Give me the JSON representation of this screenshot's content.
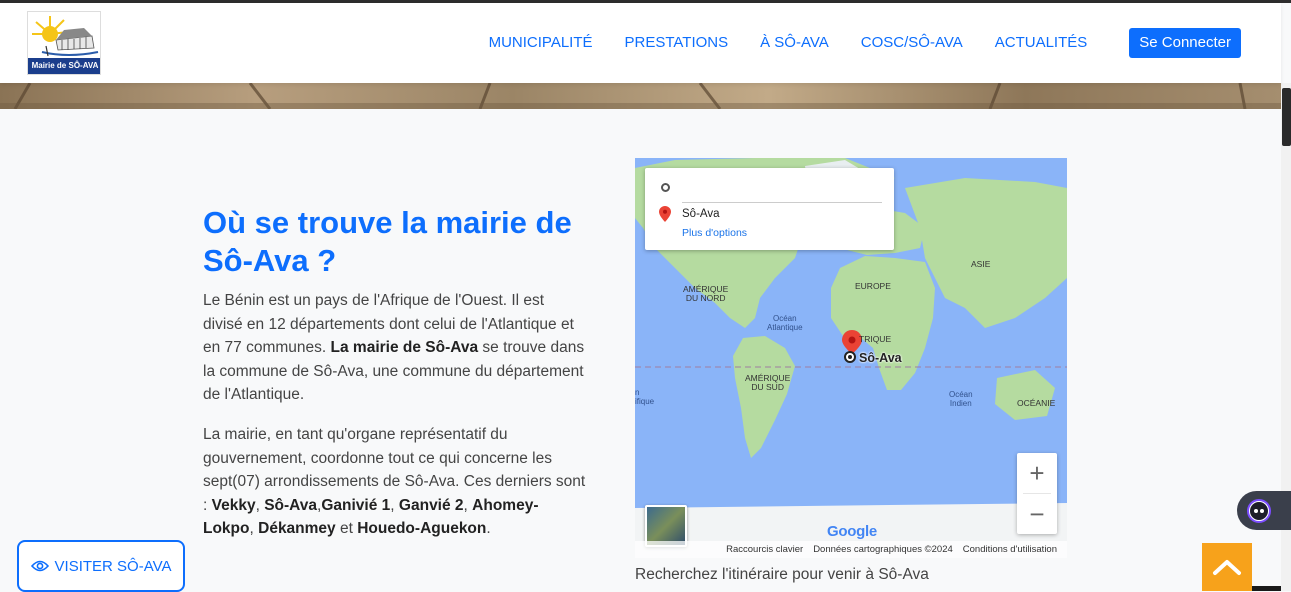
{
  "header": {
    "logo_text": "Mairie de SÔ-AVA",
    "nav": [
      "MUNICIPALITÉ",
      "PRESTATIONS",
      "À SÔ-AVA",
      "COSC/SÔ-AVA",
      "ACTUALITÉS"
    ],
    "connect_label": "Se Connecter"
  },
  "main": {
    "heading": "Où se trouve la mairie de Sô-Ava ?",
    "p1": {
      "a": "Le Bénin est un pays de l'Afrique de l'Ouest. Il est divisé en 12 départements dont celui de l'Atlantique et en 77 communes. ",
      "b": "La mairie de Sô-Ava",
      "c": " se trouve dans la commune de Sô-Ava, une commune du département de l'Atlantique."
    },
    "p2": {
      "a": "La mairie, en tant qu'organe représentatif du gouvernement, coordonne tout ce qui concerne les sept(07) arrondissements de Sô-Ava. Ces derniers sont : ",
      "names": [
        "Vekky",
        "Sô-Ava",
        "Ganivié 1",
        "Ganvié 2",
        "Ahomey-Lokpo",
        "Dékanmey",
        "Houedo-Aguekon"
      ],
      "sep1": ", ",
      "sep2": ",",
      "sep3": " ",
      "sep4": ", ",
      "sep5": ", ",
      "and": " et ",
      "end": "."
    },
    "visit_label": "VISITER SÔ-AVA"
  },
  "map": {
    "directions": {
      "origin_value": "",
      "destination": "Sô-Ava",
      "more_options": "Plus d'options"
    },
    "labels": {
      "north_america": [
        "AMÉRIQUE",
        "DU NORD"
      ],
      "south_america": [
        "AMÉRIQUE",
        "DU SUD"
      ],
      "europe": "EUROPE",
      "asia": "ASIE",
      "africa": "TRIQUE",
      "oceania": "OCÉANIE",
      "atlantic": [
        "Océan",
        "Atlantique"
      ],
      "indian": [
        "Océan",
        "Indien"
      ],
      "pacific": [
        "n",
        "ifique"
      ]
    },
    "pin_label": "Sô-Ava",
    "google": "Google",
    "footer": [
      "Raccourcis clavier",
      "Données cartographiques ©2024",
      "Conditions d'utilisation"
    ],
    "zoom_in": "+",
    "zoom_out": "−"
  },
  "caption": "Recherchez l'itinéraire pour venir à Sô-Ava",
  "colors": {
    "primary": "#0d6efd",
    "ocean": "#8ab4f8",
    "land": "#b5dba0",
    "back_to_top": "#f7a21b"
  }
}
